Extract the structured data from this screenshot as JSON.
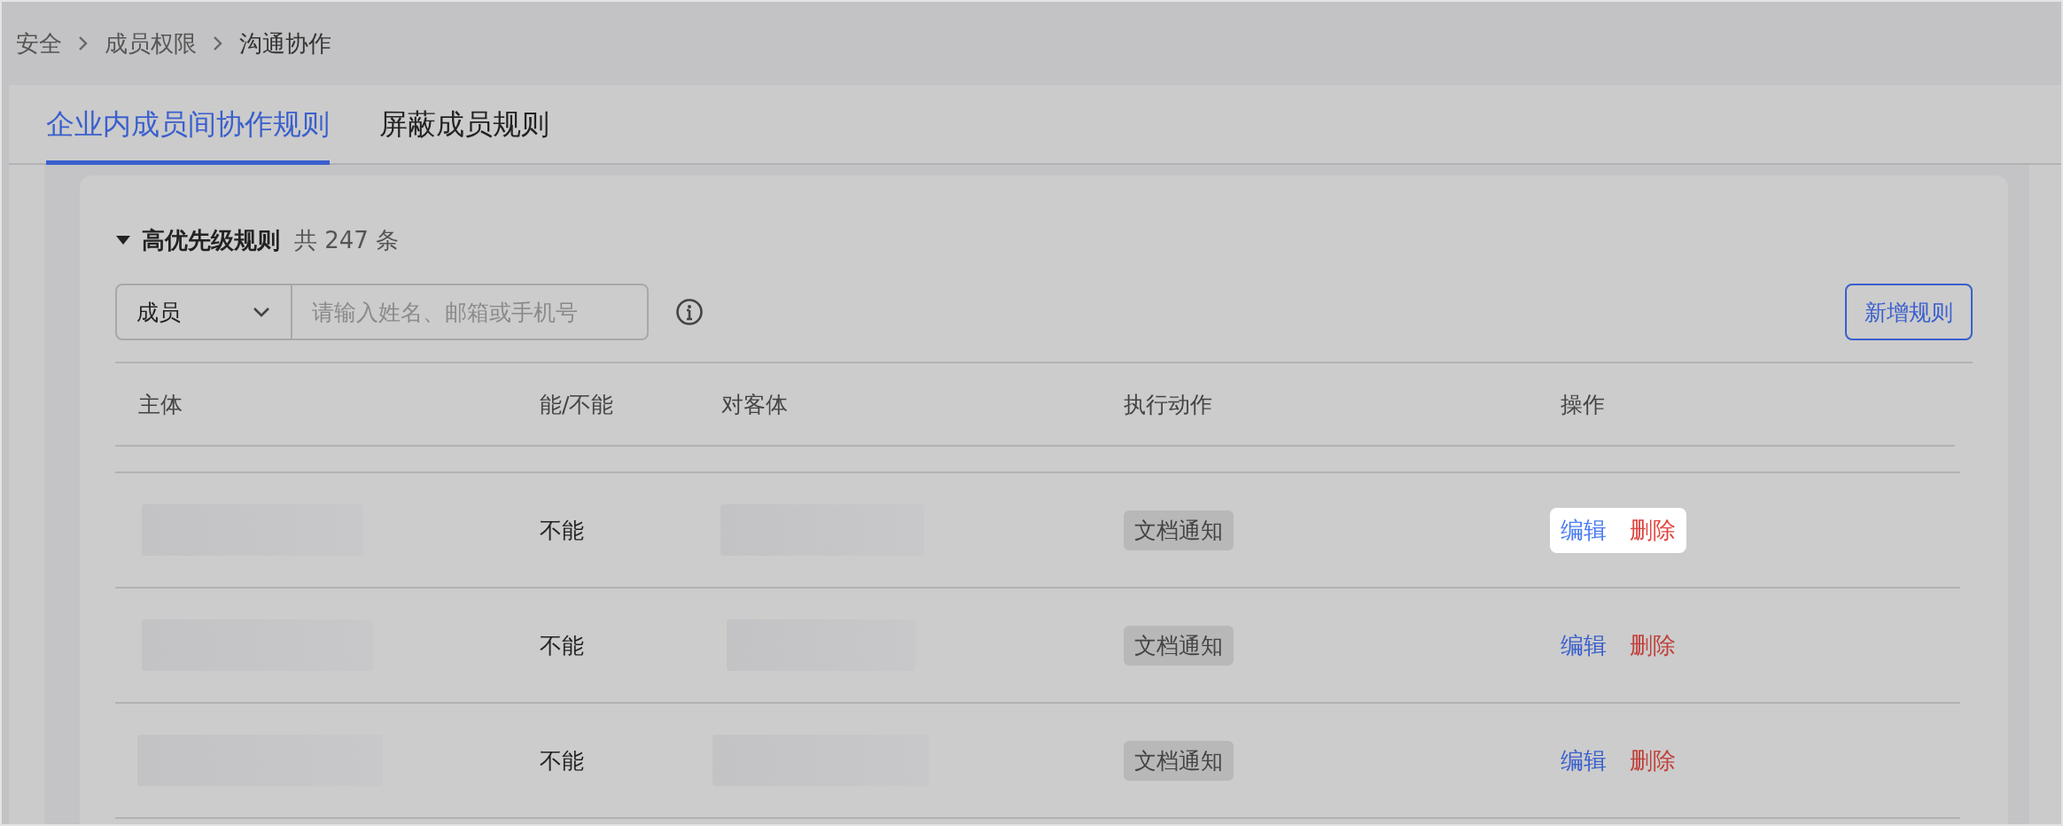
{
  "breadcrumb": [
    "安全",
    "成员权限",
    "沟通协作"
  ],
  "tabs": [
    {
      "label": "企业内成员间协作规则",
      "selected": true
    },
    {
      "label": "屏蔽成员规则",
      "selected": false
    }
  ],
  "section": {
    "title": "高优先级规则",
    "count": "共 247 条",
    "expanded": true
  },
  "filter": {
    "type": "成员",
    "placeholder": "请输入姓名、邮箱或手机号"
  },
  "add_button": "新增规则",
  "table": {
    "columns": [
      "主体",
      "能/不能",
      "对客体",
      "执行动作",
      "操作"
    ],
    "rows": [
      {
        "can": "不能",
        "action": "文档通知",
        "edit": "编辑",
        "delete": "删除",
        "highlighted": true
      },
      {
        "can": "不能",
        "action": "文档通知",
        "edit": "编辑",
        "delete": "删除",
        "highlighted": false
      },
      {
        "can": "不能",
        "action": "文档通知",
        "edit": "编辑",
        "delete": "删除",
        "highlighted": false
      }
    ]
  }
}
